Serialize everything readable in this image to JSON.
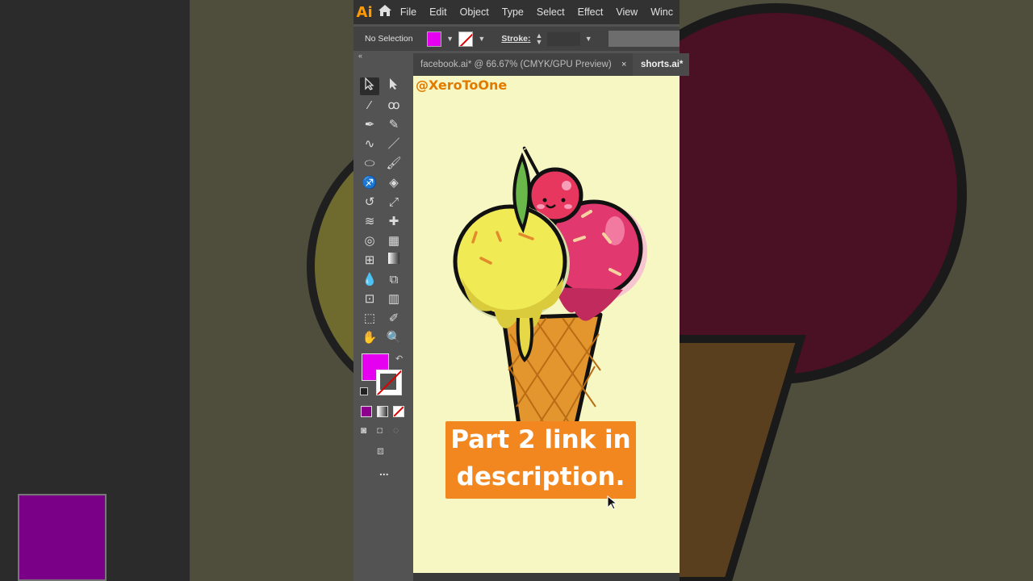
{
  "app": {
    "logo": "Ai",
    "menu": [
      "File",
      "Edit",
      "Object",
      "Type",
      "Select",
      "Effect",
      "View",
      "Winc"
    ]
  },
  "control_bar": {
    "selection_status": "No Selection",
    "stroke_label": "Stroke:"
  },
  "colors": {
    "fill": "#e600f0",
    "canvas": "#f7f7c4",
    "accent": "#ff9a00"
  },
  "tabs": [
    {
      "label": "facebook.ai* @ 66.67% (CMYK/GPU Preview)",
      "close": "×"
    },
    {
      "label": "shorts.ai*"
    }
  ],
  "canvas": {
    "watermark": "@XeroToOne",
    "caption_line1": "Part 2 link in",
    "caption_line2": "description."
  },
  "toolbar": {
    "more": "..."
  },
  "icons": [
    "home-icon",
    "selection-tool-icon",
    "direct-selection-tool-icon",
    "magic-wand-icon",
    "lasso-icon",
    "pen-tool-icon",
    "curvature-icon",
    "type-tool-icon",
    "line-tool-icon",
    "ellipse-tool-icon",
    "paintbrush-icon",
    "shaper-icon",
    "eraser-icon",
    "rotate-icon",
    "scale-icon",
    "warp-icon",
    "free-transform-icon",
    "shape-builder-icon",
    "perspective-grid-icon",
    "mesh-icon",
    "gradient-icon",
    "eyedropper-icon",
    "blend-icon",
    "symbol-sprayer-icon",
    "column-graph-icon",
    "artboard-icon",
    "slice-icon",
    "hand-icon",
    "zoom-icon"
  ]
}
